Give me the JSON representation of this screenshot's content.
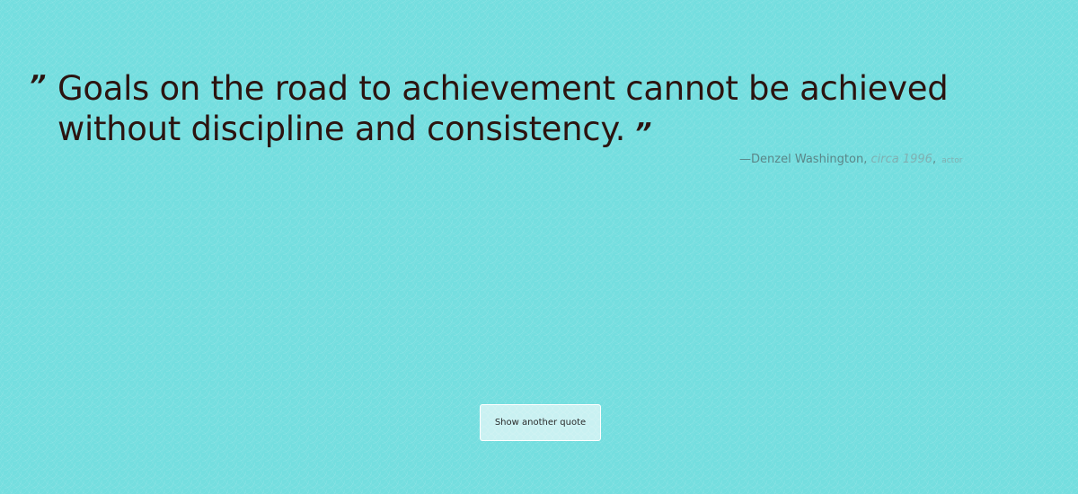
{
  "quote": {
    "open_mark": "”",
    "text": "Goals on the road to achievement cannot be achieved without discipline and consistency.",
    "close_mark": "”"
  },
  "attribution": {
    "author": "—Denzel Washington",
    "separator": ",",
    "date": "circa 1996",
    "separator2": ",",
    "role": "actor"
  },
  "button": {
    "label": "Show another quote"
  },
  "colors": {
    "background": "#74dedf",
    "quote_text": "#2b1410",
    "attribution_text": "#5a8688"
  }
}
